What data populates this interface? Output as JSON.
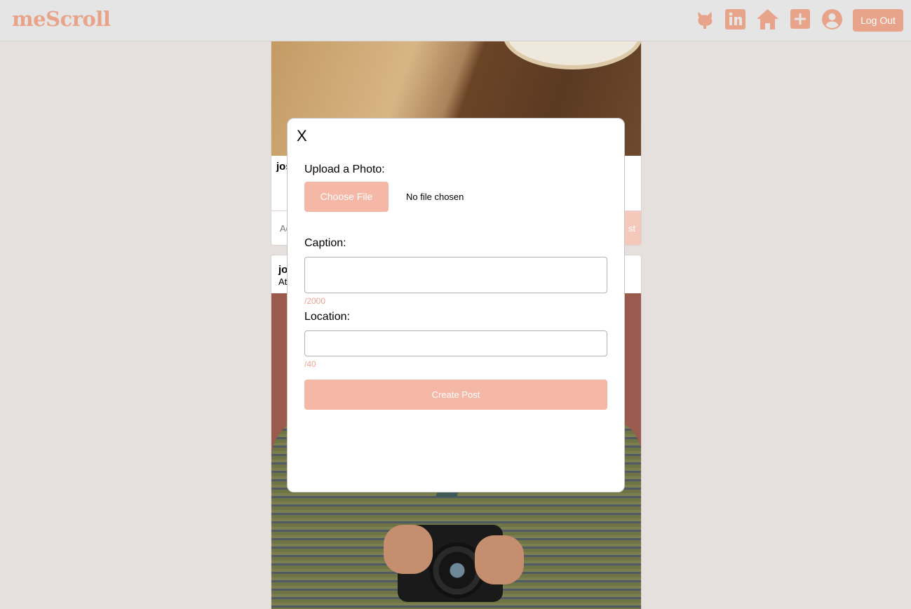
{
  "header": {
    "logo": "meScroll",
    "icons": [
      "github-icon",
      "linkedin-icon",
      "home-icon",
      "add-post-icon",
      "profile-icon"
    ],
    "logout_label": "Log Out"
  },
  "feed": {
    "post1": {
      "username": "jos",
      "comment_placeholder": "Ad",
      "post_label": "st"
    },
    "post2": {
      "username": "jo",
      "location": "At"
    }
  },
  "modal": {
    "close_label": "X",
    "upload_label": "Upload a Photo:",
    "choose_file_label": "Choose File",
    "no_file_text": "No file chosen",
    "caption_label": "Caption:",
    "caption_value": "",
    "caption_counter": "/2000",
    "location_label": "Location:",
    "location_value": "",
    "location_counter": "/40",
    "submit_label": "Create Post"
  },
  "colors": {
    "brand": "#e8a48b",
    "button_light": "#f6b8a6",
    "background": "#e5e0de"
  }
}
